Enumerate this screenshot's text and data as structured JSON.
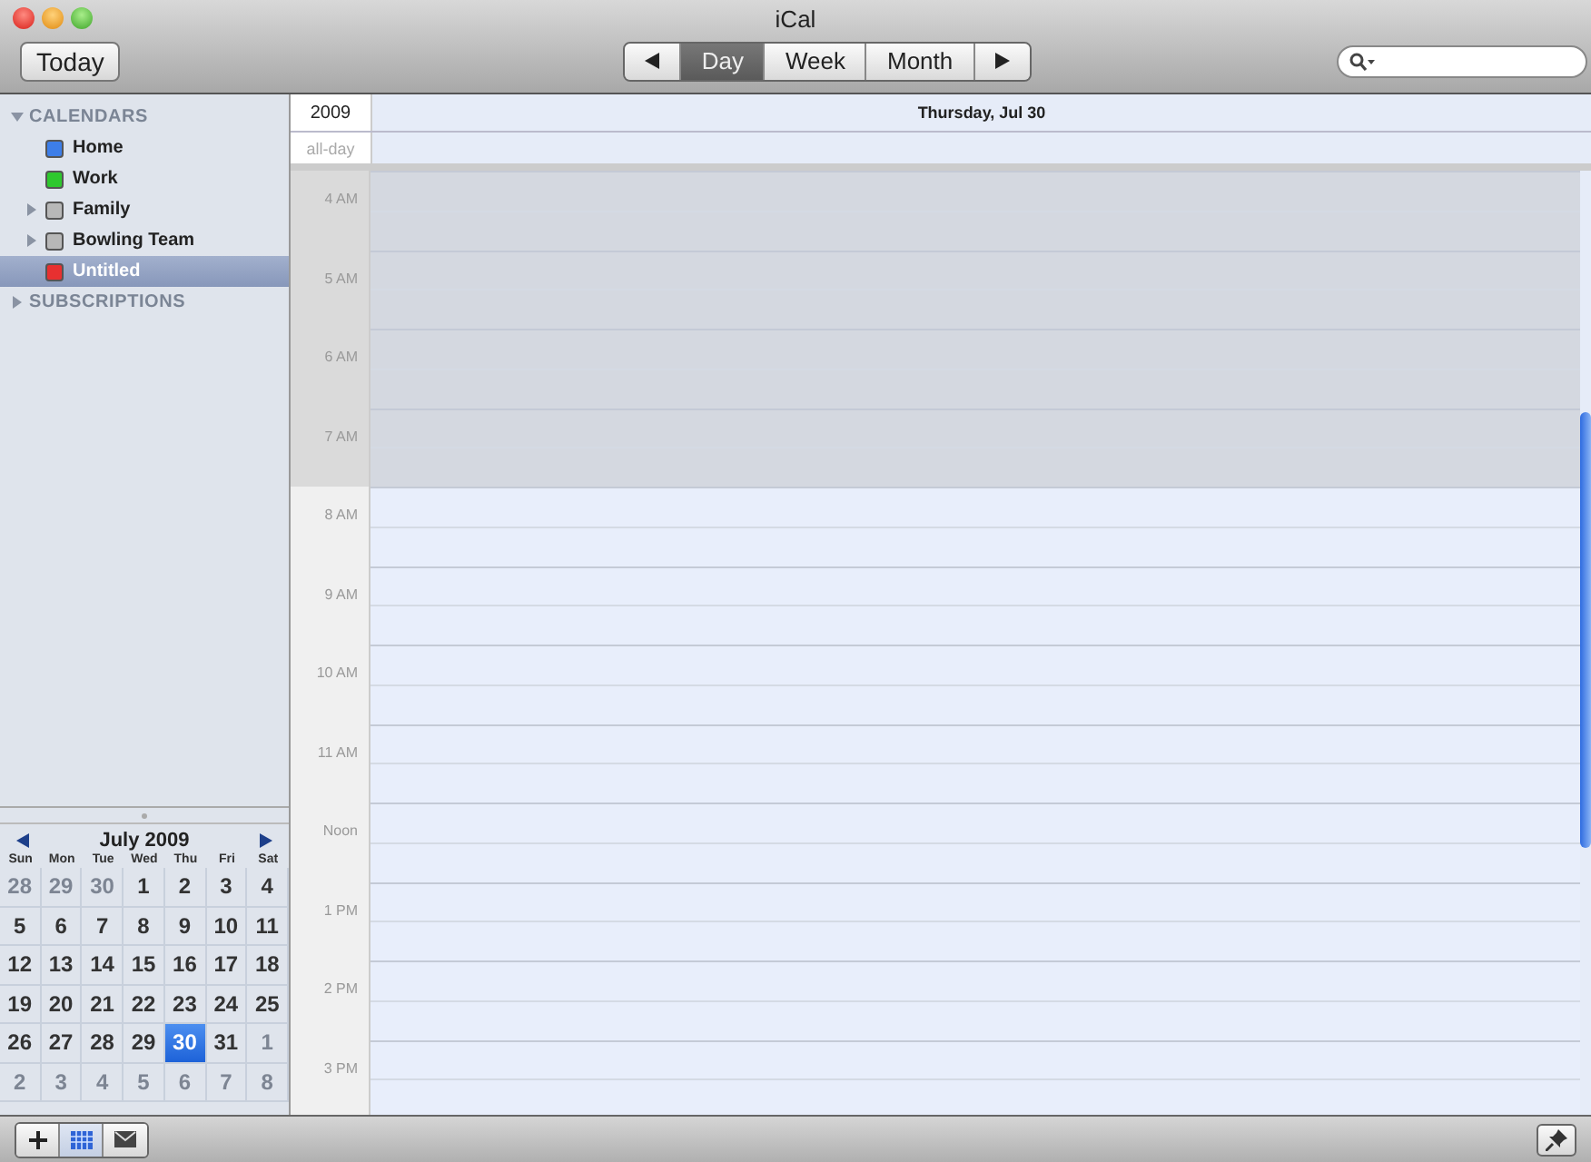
{
  "window": {
    "title": "iCal"
  },
  "toolbar": {
    "today_button": "Today",
    "views": [
      {
        "kind": "prev",
        "selected": false
      },
      {
        "kind": "label",
        "label": "Day",
        "selected": true
      },
      {
        "kind": "label",
        "label": "Week",
        "selected": false
      },
      {
        "kind": "label",
        "label": "Month",
        "selected": false
      },
      {
        "kind": "next",
        "selected": false
      }
    ]
  },
  "sidebar": {
    "sections": [
      {
        "title": "CALENDARS",
        "expanded": true,
        "items": [
          {
            "name": "Home",
            "kind": "calendar",
            "color": "#3d7ee8",
            "selected": false
          },
          {
            "name": "Work",
            "kind": "calendar",
            "color": "#2ec82e",
            "selected": false
          },
          {
            "name": "Family",
            "kind": "group",
            "color": "#b8b8b8",
            "selected": false
          },
          {
            "name": "Bowling Team",
            "kind": "group",
            "color": "#b8b8b8",
            "selected": false
          },
          {
            "name": "Untitled",
            "kind": "calendar",
            "color": "#e83030",
            "selected": true
          }
        ]
      },
      {
        "title": "SUBSCRIPTIONS",
        "expanded": false
      }
    ]
  },
  "mini_calendar": {
    "title": "July 2009",
    "weekdays": [
      "Sun",
      "Mon",
      "Tue",
      "Wed",
      "Thu",
      "Fri",
      "Sat"
    ],
    "weeks": [
      [
        {
          "label": "28",
          "kind": "other",
          "selected": false
        },
        {
          "label": "29",
          "kind": "other",
          "selected": false
        },
        {
          "label": "30",
          "kind": "other",
          "selected": false
        },
        {
          "label": "1",
          "kind": "current",
          "selected": false
        },
        {
          "label": "2",
          "kind": "current",
          "selected": false
        },
        {
          "label": "3",
          "kind": "current",
          "selected": false
        },
        {
          "label": "4",
          "kind": "current",
          "selected": false
        }
      ],
      [
        {
          "label": "5",
          "kind": "current",
          "selected": false
        },
        {
          "label": "6",
          "kind": "current",
          "selected": false
        },
        {
          "label": "7",
          "kind": "current",
          "selected": false
        },
        {
          "label": "8",
          "kind": "current",
          "selected": false
        },
        {
          "label": "9",
          "kind": "current",
          "selected": false
        },
        {
          "label": "10",
          "kind": "current",
          "selected": false
        },
        {
          "label": "11",
          "kind": "current",
          "selected": false
        }
      ],
      [
        {
          "label": "12",
          "kind": "current",
          "selected": false
        },
        {
          "label": "13",
          "kind": "current",
          "selected": false
        },
        {
          "label": "14",
          "kind": "current",
          "selected": false
        },
        {
          "label": "15",
          "kind": "current",
          "selected": false
        },
        {
          "label": "16",
          "kind": "current",
          "selected": false
        },
        {
          "label": "17",
          "kind": "current",
          "selected": false
        },
        {
          "label": "18",
          "kind": "current",
          "selected": false
        }
      ],
      [
        {
          "label": "19",
          "kind": "current",
          "selected": false
        },
        {
          "label": "20",
          "kind": "current",
          "selected": false
        },
        {
          "label": "21",
          "kind": "current",
          "selected": false
        },
        {
          "label": "22",
          "kind": "current",
          "selected": false
        },
        {
          "label": "23",
          "kind": "current",
          "selected": false
        },
        {
          "label": "24",
          "kind": "current",
          "selected": false
        },
        {
          "label": "25",
          "kind": "current",
          "selected": false
        }
      ],
      [
        {
          "label": "26",
          "kind": "current",
          "selected": false
        },
        {
          "label": "27",
          "kind": "current",
          "selected": false
        },
        {
          "label": "28",
          "kind": "current",
          "selected": false
        },
        {
          "label": "29",
          "kind": "current",
          "selected": false
        },
        {
          "label": "30",
          "kind": "current",
          "selected": true
        },
        {
          "label": "31",
          "kind": "current",
          "selected": false
        },
        {
          "label": "1",
          "kind": "other",
          "selected": false
        }
      ],
      [
        {
          "label": "2",
          "kind": "other",
          "selected": false
        },
        {
          "label": "3",
          "kind": "other",
          "selected": false
        },
        {
          "label": "4",
          "kind": "other",
          "selected": false
        },
        {
          "label": "5",
          "kind": "other",
          "selected": false
        },
        {
          "label": "6",
          "kind": "other",
          "selected": false
        },
        {
          "label": "7",
          "kind": "other",
          "selected": false
        },
        {
          "label": "8",
          "kind": "other",
          "selected": false
        }
      ]
    ]
  },
  "day_view": {
    "year": "2009",
    "date": "Thursday, Jul 30",
    "all_day_label": "all-day",
    "hours": [
      {
        "label": "4 AM",
        "off_hours": true
      },
      {
        "label": "5 AM",
        "off_hours": true
      },
      {
        "label": "6 AM",
        "off_hours": true
      },
      {
        "label": "7 AM",
        "off_hours": true
      },
      {
        "label": "8 AM",
        "off_hours": false
      },
      {
        "label": "9 AM",
        "off_hours": false
      },
      {
        "label": "10 AM",
        "off_hours": false
      },
      {
        "label": "11 AM",
        "off_hours": false
      },
      {
        "label": "Noon",
        "off_hours": false
      },
      {
        "label": "1 PM",
        "off_hours": false
      },
      {
        "label": "2 PM",
        "off_hours": false
      },
      {
        "label": "3 PM",
        "off_hours": false
      }
    ]
  },
  "bottom_bar": {
    "view_buttons": [
      {
        "kind": "add",
        "selected": false
      },
      {
        "kind": "calendar",
        "selected": true
      },
      {
        "kind": "mail",
        "selected": false
      }
    ]
  }
}
